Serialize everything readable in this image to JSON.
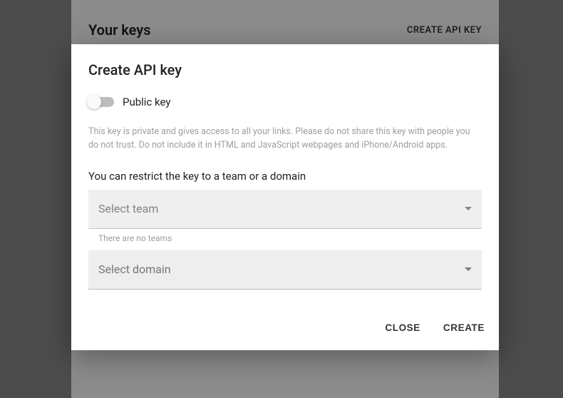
{
  "page": {
    "title": "Your keys",
    "create_link": "CREATE API KEY"
  },
  "dialog": {
    "title": "Create API key",
    "toggle": {
      "label": "Public key",
      "on": false
    },
    "description": "This key is private and gives access to all your links. Please do not share this key with people you do not trust. Do not include it in HTML and JavaScript webpages and iPhone/Android apps.",
    "restrict_label": "You can restrict the key to a team or a domain",
    "team_select": {
      "placeholder": "Select team",
      "helper": "There are no teams"
    },
    "domain_select": {
      "placeholder": "Select domain"
    },
    "actions": {
      "close": "CLOSE",
      "create": "CREATE"
    }
  }
}
